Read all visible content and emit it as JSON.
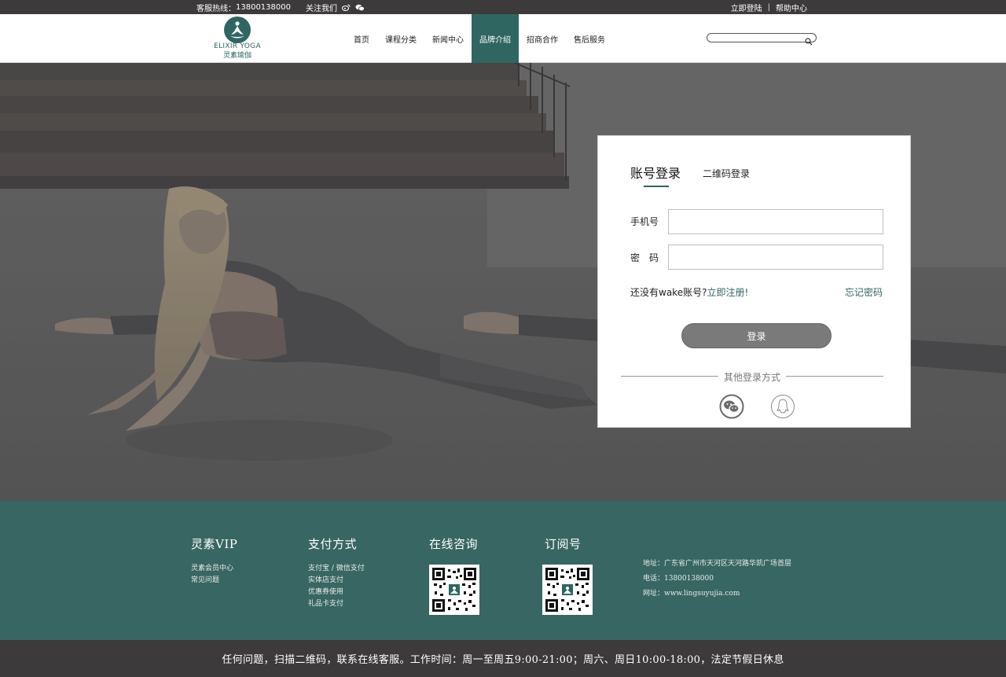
{
  "topbar": {
    "hotline_label": "客服热线：",
    "hotline_number": "13800138000",
    "follow_label": "关注我们",
    "login_link": "立即登陆",
    "separator": "|",
    "help_link": "帮助中心"
  },
  "header": {
    "logo_en": "ELIXIR YOGA",
    "logo_cn": "灵素瑜伽",
    "nav": [
      {
        "label": "首页",
        "active": false
      },
      {
        "label": "课程分类",
        "active": false
      },
      {
        "label": "新闻中心",
        "active": false
      },
      {
        "label": "品牌介绍",
        "active": true
      },
      {
        "label": "招商合作",
        "active": false
      },
      {
        "label": "售后服务",
        "active": false
      }
    ],
    "search_placeholder": ""
  },
  "login": {
    "tab_account": "账号登录",
    "tab_qr": "二维码登录",
    "phone_label": "手机号",
    "phone_value": "",
    "password_label": "密　码",
    "password_value": "",
    "no_account": "还没有wake账号?",
    "register_link": "立即注册!",
    "forgot": "忘记密码",
    "submit": "登录",
    "other_methods": "其他登录方式"
  },
  "footer": {
    "vip": {
      "title": "灵素VIP",
      "links": [
        "灵素会员中心",
        "常见问题"
      ]
    },
    "payment": {
      "title": "支付方式",
      "links": [
        "支付宝 / 微信支付",
        "实体店支付",
        "优惠券使用",
        "礼品卡支付"
      ]
    },
    "consult": {
      "title": "在线咨询"
    },
    "subscribe": {
      "title": "订阅号"
    },
    "contact": {
      "address": "地址：广东省广州市天河区天河路华凯广场首层",
      "phone": "电话：13800138000",
      "website": "网址：www.lingsuyujia.com"
    },
    "bottom_notice": "任何问题，扫描二维码，联系在线客服。工作时间：周一至周五9:00-21:00；周六、周日10:00-18:00，法定节假日休息"
  },
  "colors": {
    "brand": "#2f6661",
    "footer_bg": "#386662",
    "dark_bar": "#3d3a3b",
    "login_button": "#7a7a7a"
  },
  "icons": [
    "weibo-icon",
    "wechat-icon",
    "search-icon",
    "logo-meditation-icon",
    "wechat-login-icon",
    "qq-login-icon",
    "qr-code-icon"
  ]
}
